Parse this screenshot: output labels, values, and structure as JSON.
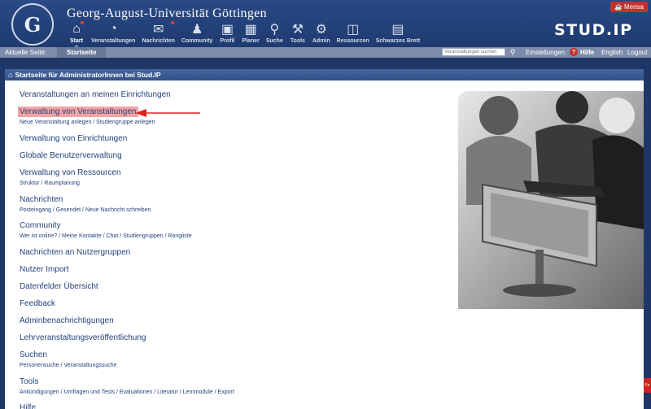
{
  "header": {
    "university_name": "Georg-August-Universität Göttingen",
    "mensa_label": "Mensa",
    "brand": "STUD.IP"
  },
  "nav": [
    {
      "label": "Start",
      "icon": "home-icon",
      "glyph": "⌂",
      "active": true,
      "dot": true
    },
    {
      "label": "Veranstaltungen",
      "icon": "seminar-icon",
      "glyph": "◔",
      "active": false,
      "dot": false
    },
    {
      "label": "Nachrichten",
      "icon": "mail-icon",
      "glyph": "✉",
      "active": false,
      "dot": true
    },
    {
      "label": "Community",
      "icon": "community-icon",
      "glyph": "♟",
      "active": false,
      "dot": false
    },
    {
      "label": "Profil",
      "icon": "profile-icon",
      "glyph": "▣",
      "active": false,
      "dot": false
    },
    {
      "label": "Planer",
      "icon": "calendar-icon",
      "glyph": "▦",
      "active": false,
      "dot": false
    },
    {
      "label": "Suche",
      "icon": "search-icon",
      "glyph": "⚲",
      "active": false,
      "dot": false
    },
    {
      "label": "Tools",
      "icon": "tools-icon",
      "glyph": "⚒",
      "active": false,
      "dot": false
    },
    {
      "label": "Admin",
      "icon": "admin-icon",
      "glyph": "⚙",
      "active": false,
      "dot": false
    },
    {
      "label": "Ressourcen",
      "icon": "resources-icon",
      "glyph": "◫",
      "active": false,
      "dot": false
    },
    {
      "label": "Schwarzes Brett",
      "icon": "board-icon",
      "glyph": "▤",
      "active": false,
      "dot": false
    }
  ],
  "subnav": {
    "current_page_label": "Aktuelle Seite:",
    "current_page": "Startseite",
    "search_placeholder": "Veranstaltungen suchen",
    "settings": "Einstellungen",
    "help": "Hilfe",
    "language": "English",
    "logout": "Logout"
  },
  "panel": {
    "title": "Startseite für AdministratorInnen bei Stud.IP"
  },
  "menu": [
    {
      "title": "Veranstaltungen an meinen Einrichtungen",
      "sub": ""
    },
    {
      "title": "Verwaltung von Veranstaltungen",
      "sub": "Neue Veranstaltung anlegen / Studiengruppe anlegen",
      "highlighted": true
    },
    {
      "title": "Verwaltung von Einrichtungen",
      "sub": ""
    },
    {
      "title": "Globale Benutzerverwaltung",
      "sub": ""
    },
    {
      "title": "Verwaltung von Ressourcen",
      "sub": "Struktur / Raumplanung"
    },
    {
      "title": "Nachrichten",
      "sub": "Posteingang / Gesendet / Neue Nachricht schreiben"
    },
    {
      "title": "Community",
      "sub": "Wer ist online? / Meine Kontakte / Chat / Studiengruppen / Rangliste"
    },
    {
      "title": "Nachrichten an Nutzergruppen",
      "sub": ""
    },
    {
      "title": "Nutzer Import",
      "sub": ""
    },
    {
      "title": "Datenfelder Übersicht",
      "sub": ""
    },
    {
      "title": "Feedback",
      "sub": ""
    },
    {
      "title": "Adminbenachrichtigungen",
      "sub": ""
    },
    {
      "title": "Lehrveranstaltungsveröffentlichung",
      "sub": ""
    },
    {
      "title": "Suchen",
      "sub": "Personensuche / Veranstaltungssuche"
    },
    {
      "title": "Tools",
      "sub": "Ankündigungen / Umfragen und Tests / Evaluationen / Literatur / Lernmodule / Export"
    },
    {
      "title": "Hilfe",
      "sub": ""
    }
  ],
  "side_tab_label": "Fe",
  "colors": {
    "header_bg": "#1e3a70",
    "subnav_bg": "#7e8cab",
    "link": "#24437c",
    "highlight": "#f3a3a3",
    "arrow": "#e02020",
    "alert_red": "#c8302c"
  }
}
